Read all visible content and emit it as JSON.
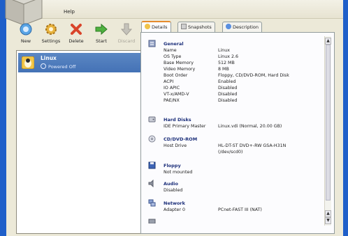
{
  "menubar": {
    "help_label": "Help"
  },
  "toolbar": {
    "buttons": [
      {
        "label": "New"
      },
      {
        "label": "Settings"
      },
      {
        "label": "Delete"
      },
      {
        "label": "Start"
      },
      {
        "label": "Discard"
      }
    ]
  },
  "vm_list": {
    "items": [
      {
        "name": "Linux",
        "state": "Powered Off"
      }
    ]
  },
  "tabs": [
    {
      "label": "Details"
    },
    {
      "label": "Snapshots"
    },
    {
      "label": "Description"
    }
  ],
  "details": {
    "general": {
      "title": "General",
      "rows": [
        {
          "k": "Name",
          "v": "Linux"
        },
        {
          "k": "OS Type",
          "v": "Linux 2.6"
        },
        {
          "k": "Base Memory",
          "v": "512 MB"
        },
        {
          "k": "Video Memory",
          "v": "8 MB"
        },
        {
          "k": "Boot Order",
          "v": "Floppy, CD/DVD-ROM, Hard Disk"
        },
        {
          "k": "ACPI",
          "v": "Enabled"
        },
        {
          "k": "IO APIC",
          "v": "Disabled"
        },
        {
          "k": "VT-x/AMD-V",
          "v": "Disabled"
        },
        {
          "k": "PAE/NX",
          "v": "Disabled"
        }
      ]
    },
    "hard_disks": {
      "title": "Hard Disks",
      "rows": [
        {
          "k": "IDE Primary Master",
          "v": "Linux.vdi (Normal, 20.00 GB)"
        }
      ]
    },
    "cdrom": {
      "title": "CD/DVD-ROM",
      "rows": [
        {
          "k": "Host Drive",
          "v": "HL-DT-ST DVD+-RW GSA-H31N"
        },
        {
          "k": "",
          "v": "(/dev/scd0)"
        }
      ]
    },
    "floppy": {
      "title": "Floppy",
      "rows": [
        {
          "k": "Not mounted",
          "v": ""
        }
      ]
    },
    "audio": {
      "title": "Audio",
      "rows": [
        {
          "k": "Disabled",
          "v": ""
        }
      ]
    },
    "network": {
      "title": "Network",
      "rows": [
        {
          "k": "Adapter 0",
          "v": "PCnet-FAST III (NAT)"
        }
      ]
    }
  }
}
